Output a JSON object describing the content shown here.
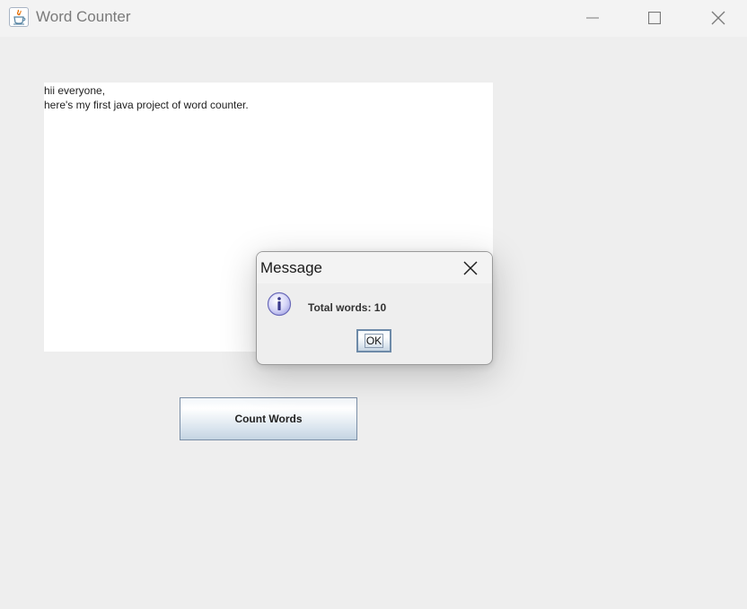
{
  "window": {
    "title": "Word Counter",
    "app_icon": "java-icon",
    "controls": {
      "minimize_icon": "minimize-icon",
      "maximize_icon": "maximize-icon",
      "close_icon": "close-icon"
    }
  },
  "text_area": {
    "lines": [
      "hii everyone,",
      "here's my first java project of word counter."
    ]
  },
  "count_button": {
    "label": "Count Words"
  },
  "dialog": {
    "title": "Message",
    "icon": "info-icon",
    "message": "Total words: 10",
    "ok_label": "OK",
    "close_icon": "close-icon"
  },
  "colors": {
    "window_background": "#eeeeee",
    "titlebar_background": "#f3f3f3",
    "text_area_background": "#ffffff",
    "button_border": "#7a8ea6",
    "info_icon_fill": "#c9c9f2"
  }
}
